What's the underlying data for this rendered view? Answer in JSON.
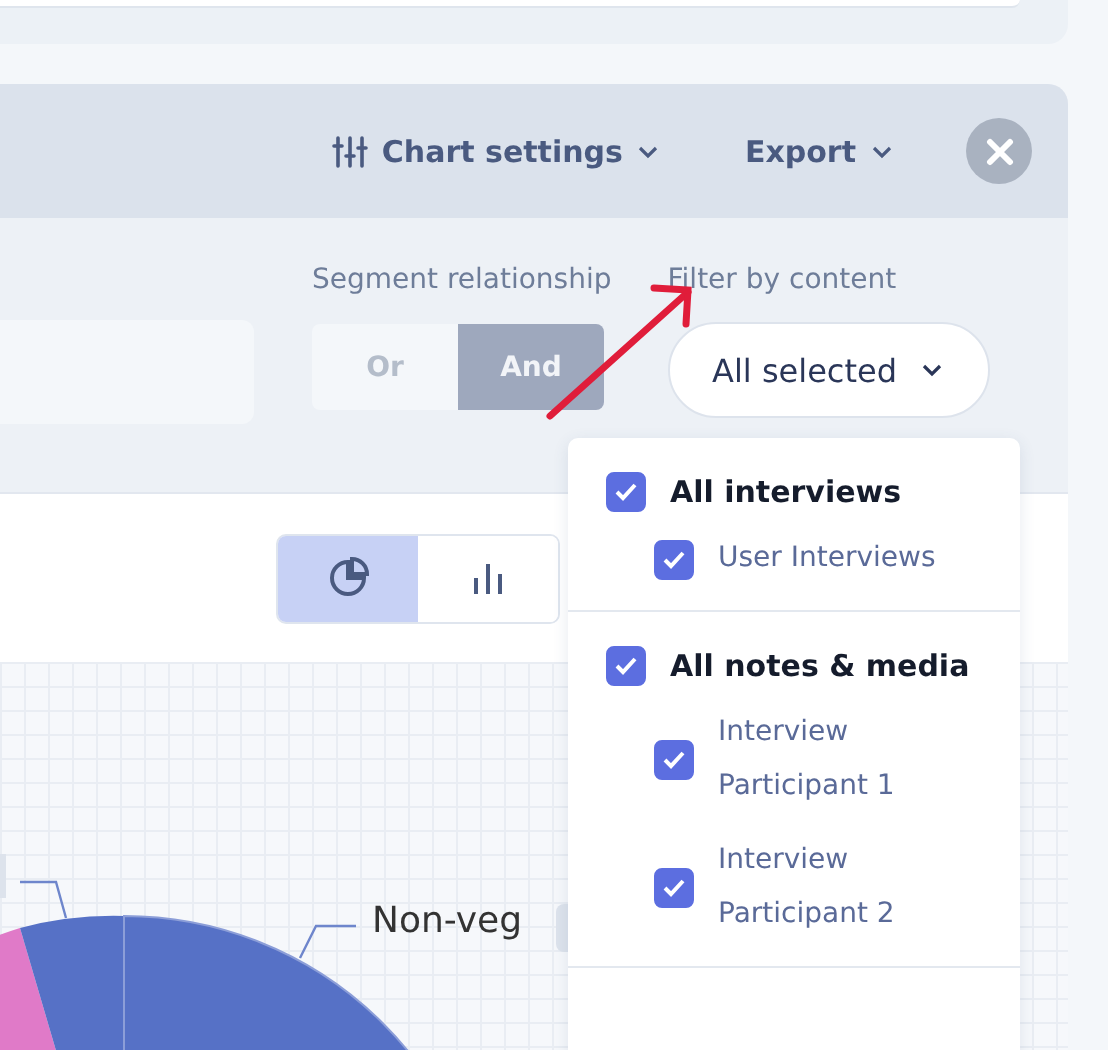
{
  "toolbar": {
    "chart_settings": "Chart settings",
    "export": "Export"
  },
  "filters": {
    "segment_label": "Segment relationship",
    "segment_options": [
      {
        "label": "Or",
        "selected": false
      },
      {
        "label": "And",
        "selected": true
      }
    ],
    "content_label": "Filter by content",
    "content_value": "All selected"
  },
  "chart_types": [
    {
      "kind": "pie",
      "selected": true
    },
    {
      "kind": "bar",
      "selected": false
    }
  ],
  "chart": {
    "label": "Non-veg"
  },
  "dropdown": [
    {
      "label": "All interviews",
      "checked": true,
      "children": [
        {
          "label": "User Interviews",
          "checked": true
        }
      ]
    },
    {
      "label": "All notes & media",
      "checked": true,
      "children": [
        {
          "label": "Interview Participant 1",
          "checked": true
        },
        {
          "label": "Interview Participant 2",
          "checked": true
        }
      ]
    }
  ]
}
